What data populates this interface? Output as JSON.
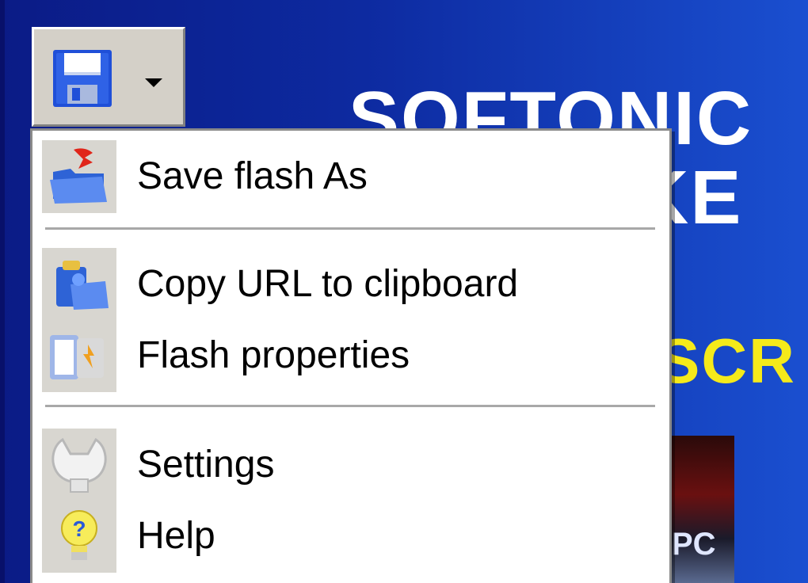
{
  "background": {
    "title_line1": "SOFTONIC",
    "title_line2": "KE",
    "yellow_text": "SCR",
    "box_label": "PC"
  },
  "toolbar": {
    "save_icon": "floppy-disk-icon",
    "dropdown_icon": "dropdown-arrow-icon"
  },
  "menu": {
    "items": [
      {
        "label": "Save flash As",
        "icon": "save-flash-icon"
      },
      {
        "label": "Copy URL to clipboard",
        "icon": "copy-url-icon"
      },
      {
        "label": "Flash properties",
        "icon": "flash-properties-icon"
      },
      {
        "label": "Settings",
        "icon": "settings-icon"
      },
      {
        "label": "Help",
        "icon": "help-icon"
      }
    ]
  },
  "colors": {
    "background_blue": "#0d2aa0",
    "menu_bg": "#ffffff",
    "gutter": "#d8d6d0",
    "yellow_accent": "#f5ea1a"
  }
}
